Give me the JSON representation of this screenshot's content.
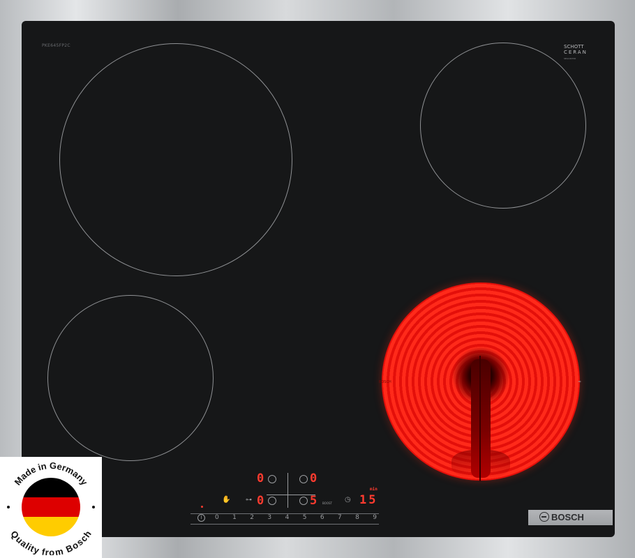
{
  "product": {
    "model_code": "PKE645FP2C",
    "glass_brand": "SCHOTT",
    "glass_type": "CERAN",
    "glass_sub": "SEA100700"
  },
  "control_panel": {
    "zone_front_left_level": "0",
    "zone_rear_right_level": "0",
    "zone_front_left_bottom_level": "0",
    "zone_front_right_level": "5",
    "timer_unit": "min",
    "timer_value": "15",
    "boost_label": "BOOST",
    "slider_numbers": [
      "0",
      "1",
      "2",
      "3",
      "4",
      "5",
      "6",
      "7",
      "8",
      "9"
    ],
    "power_label": "I"
  },
  "brand": {
    "name": "BOSCH",
    "logo_mark": "BOSCH"
  },
  "seal": {
    "top_text": "Made in Germany",
    "bottom_text": "Quality from Bosch",
    "flag_colors": [
      "#000000",
      "#dd0000",
      "#ffcc00"
    ]
  },
  "icons": {
    "power": "power-icon",
    "childlock": "hand-icon",
    "key": "key-icon",
    "timer": "clock-icon"
  },
  "colors": {
    "glass": "#161718",
    "heating_red": "#f21e12",
    "display_red": "#ff3b2f",
    "frame_steel": "#c5c7c9"
  }
}
